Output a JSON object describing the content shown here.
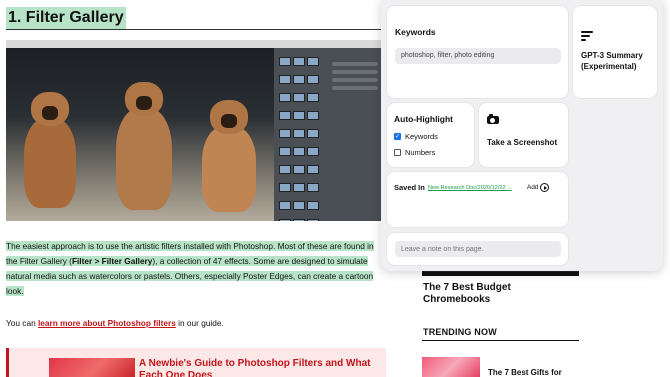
{
  "article": {
    "heading": "1. Filter Gallery",
    "para_parts": {
      "p1": "The easiest approach is to use the artistic filters installed with Photoshop. Most of these are found in the Filter Gallery (",
      "p1_bold": "Filter > Filter Gallery",
      "p2": "), a collection of 47 effects. Some are designed to simulate natural media such as watercolors or pastels. Others, especially Poster Edges, can create a cartoon look."
    },
    "guide_prefix": "You can ",
    "guide_link": "learn more about Photoshop filters",
    "guide_suffix": " in our guide.",
    "related_title": "A Newbie's Guide to Photoshop Filters and What Each One Does"
  },
  "sidebar": {
    "article_title": "The 7 Best Budget Chromebooks",
    "trending_heading": "TRENDING NOW",
    "trending_item": "The 7 Best Gifts for"
  },
  "extension": {
    "keywords": {
      "title": "Keywords",
      "value": "photoshop, filter, photo editing"
    },
    "gpt": {
      "label": "GPT-3 Summary (Experimental)",
      "icon": "summary-lines-icon"
    },
    "auto_highlight": {
      "title": "Auto-Highlight",
      "options": [
        {
          "label": "Keywords",
          "checked": true
        },
        {
          "label": "Numbers",
          "checked": false
        }
      ]
    },
    "screenshot": {
      "label": "Take a Screenshot",
      "icon": "camera-icon"
    },
    "saved_in": {
      "title": "Saved In",
      "path": "New Research Doc/2020/12/22 ...",
      "add_label": "Add"
    },
    "note": {
      "placeholder": "Leave a note on this page."
    }
  },
  "colors": {
    "highlight": "#b7e4c7",
    "link_red": "#c0151b",
    "saved_link": "#1a9e4b",
    "checkbox_blue": "#1a73e8"
  }
}
